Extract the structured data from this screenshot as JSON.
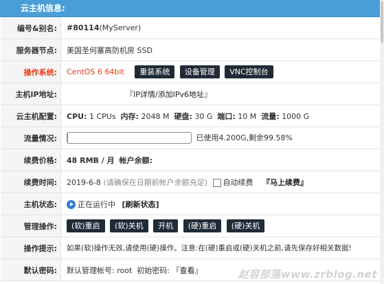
{
  "header": {
    "title": "云主机信息:"
  },
  "rows": {
    "id": {
      "label": "编号&别名:",
      "number": "#80114",
      "alias": "(MyServer)"
    },
    "node": {
      "label": "服务器节点:",
      "value": "美国圣何塞高防机房 SSD"
    },
    "os": {
      "label": "操作系统:",
      "value": "CentOS 6 64bit",
      "reinstall": "重装系统",
      "manage": "设备管理",
      "vnc": "VNC控制台"
    },
    "ip": {
      "label": "主机IP地址:",
      "link": "『IP详情/添加IPv6地址』"
    },
    "config": {
      "label": "云主机配置:",
      "cpu_label": "CPU:",
      "cpu": "1 CPUs",
      "mem_label": "内存:",
      "mem": "2048 M",
      "disk_label": "硬盘:",
      "disk": "30 G",
      "port_label": "端口:",
      "port": "10 M",
      "traffic_label": "流量:",
      "traffic": "1000 G"
    },
    "traffic": {
      "label": "流量情况:",
      "used_fraction": 0.0042,
      "text": "已使用4.200G,剩余99.58%"
    },
    "price": {
      "label": "续费价格:",
      "value": "48 RMB / 月",
      "balance_label": "帐户余额:"
    },
    "renew": {
      "label": "续费时间:",
      "date": "2019-6-8",
      "note": "(请确保在日期前帐户余额充足)",
      "auto": "自动续费",
      "now": "『马上续费』"
    },
    "status": {
      "label": "主机状态:",
      "value": "正在运行中",
      "refresh": "[刷新状态]"
    },
    "ops": {
      "label": "管理操作:",
      "soft_restart": "(软)重启",
      "soft_shutdown": "(软)关机",
      "boot": "开机",
      "hard_restart": "(硬)重启",
      "hard_shutdown": "(硬)关机"
    },
    "tip": {
      "label": "操作提示:",
      "value": "如果(软)操作无效,请使用(硬)操作。注意:在(硬)重启或(硬)关机之前,请先保存好相关数据!"
    },
    "password": {
      "label": "默认密码:",
      "user_prefix": "默认管理帐号:",
      "user": "root",
      "pwd_label": "初始密码:",
      "view": "『查看』"
    }
  },
  "watermark": "赵容部落www.zrblog.net",
  "colors": {
    "header": "#4a9ed8",
    "button": "#1f2b37",
    "red": "#e03c1a"
  }
}
